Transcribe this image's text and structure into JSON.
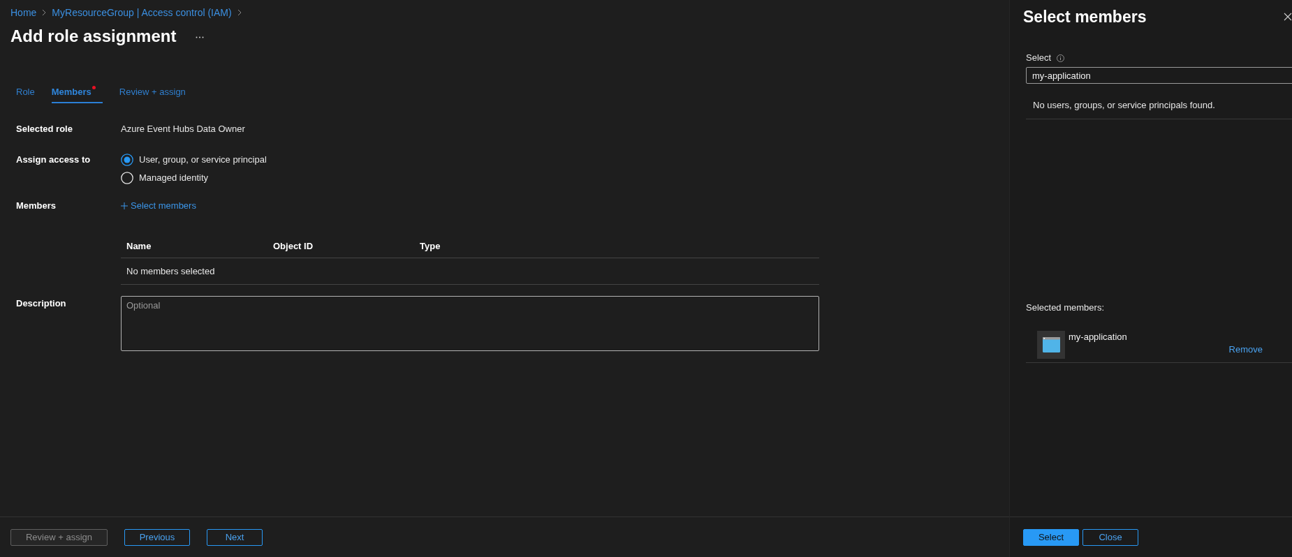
{
  "breadcrumb": [
    {
      "label": "Home"
    },
    {
      "label": "MyResourceGroup | Access control (IAM)"
    }
  ],
  "page_title": "Add role assignment",
  "tabs": [
    {
      "label": "Role",
      "selected": false,
      "attention": false
    },
    {
      "label": "Members",
      "selected": true,
      "attention": true
    },
    {
      "label": "Review + assign",
      "selected": false,
      "attention": false
    }
  ],
  "form": {
    "selected_role": {
      "label": "Selected role",
      "value": "Azure Event Hubs Data Owner"
    },
    "assign_access": {
      "label": "Assign access to",
      "options": [
        {
          "label": "User, group, or service principal",
          "selected": true
        },
        {
          "label": "Managed identity",
          "selected": false
        }
      ]
    },
    "members": {
      "label": "Members",
      "link": "Select members"
    },
    "members_table": {
      "columns": [
        "Name",
        "Object ID",
        "Type"
      ],
      "empty_text": "No members selected"
    },
    "description": {
      "label": "Description",
      "placeholder": "Optional"
    }
  },
  "footer_buttons": [
    {
      "label": "Review + assign",
      "kind": "outline",
      "disabled": true
    },
    {
      "label": "Previous",
      "kind": "outline",
      "disabled": false
    },
    {
      "label": "Next",
      "kind": "outline",
      "disabled": false
    }
  ],
  "panel": {
    "title": "Select members",
    "search": {
      "label": "Select",
      "value": "my-application"
    },
    "no_results": "No users, groups, or service principals found.",
    "selected_heading": "Selected members:",
    "selected_members": [
      {
        "name": "my-application",
        "action": "Remove"
      }
    ],
    "buttons": [
      {
        "label": "Select",
        "kind": "primary",
        "disabled": false
      },
      {
        "label": "Close",
        "kind": "outline",
        "disabled": false
      }
    ]
  }
}
